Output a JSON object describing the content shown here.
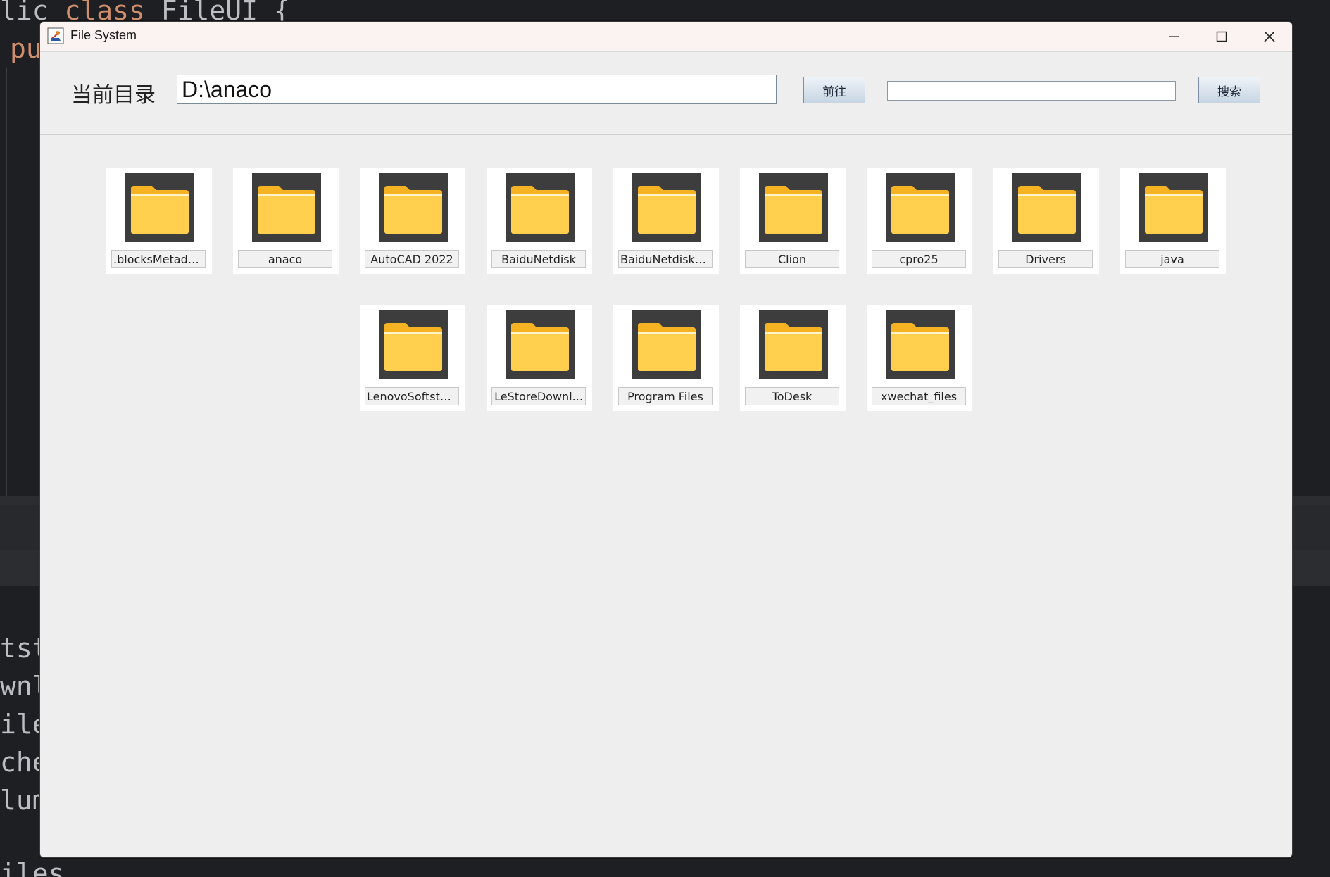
{
  "editor": {
    "lines": [
      {
        "prefix": "lic ",
        "keyword": "class",
        "rest": " FileUI {"
      },
      {
        "prefix": "",
        "keyword": "pu",
        "rest": ""
      },
      {
        "prefix": "tst",
        "keyword": "",
        "rest": ""
      },
      {
        "prefix": "wnl",
        "keyword": "",
        "rest": ""
      },
      {
        "prefix": "ile",
        "keyword": "",
        "rest": ""
      },
      {
        "prefix": "che",
        "keyword": "",
        "rest": ""
      },
      {
        "prefix": "lum",
        "keyword": "",
        "rest": ""
      },
      {
        "prefix": "iles",
        "keyword": "",
        "rest": ""
      }
    ]
  },
  "window": {
    "title": "File System",
    "controls": {
      "minimize": "minimize",
      "maximize": "maximize",
      "close": "close"
    }
  },
  "toolbar": {
    "dir_label": "当前目录",
    "path_value": "D:\\anaco",
    "go_label": "前往",
    "search_value": "",
    "search_label": "搜索"
  },
  "folders": [
    {
      "name": ".blocksMetada...",
      "icon": "folder-icon"
    },
    {
      "name": "anaco",
      "icon": "folder-icon"
    },
    {
      "name": "AutoCAD 2022",
      "icon": "folder-icon"
    },
    {
      "name": "BaiduNetdisk",
      "icon": "folder-icon"
    },
    {
      "name": "BaiduNetdiskD...",
      "icon": "folder-icon"
    },
    {
      "name": "Clion",
      "icon": "folder-icon"
    },
    {
      "name": "cpro25",
      "icon": "folder-icon"
    },
    {
      "name": "Drivers",
      "icon": "folder-icon"
    },
    {
      "name": "java",
      "icon": "folder-icon"
    },
    {
      "name": "LenovoSoftsto...",
      "icon": "folder-icon"
    },
    {
      "name": "LeStoreDownl...",
      "icon": "folder-icon"
    },
    {
      "name": "Program Files",
      "icon": "folder-icon"
    },
    {
      "name": "ToDesk",
      "icon": "folder-icon"
    },
    {
      "name": "xwechat_files",
      "icon": "folder-icon"
    }
  ],
  "colors": {
    "folder_body": "#ffcf4d",
    "folder_tab": "#f5b324",
    "thumb_bg": "#3d3d3d",
    "button_border": "#7a8ea6"
  }
}
